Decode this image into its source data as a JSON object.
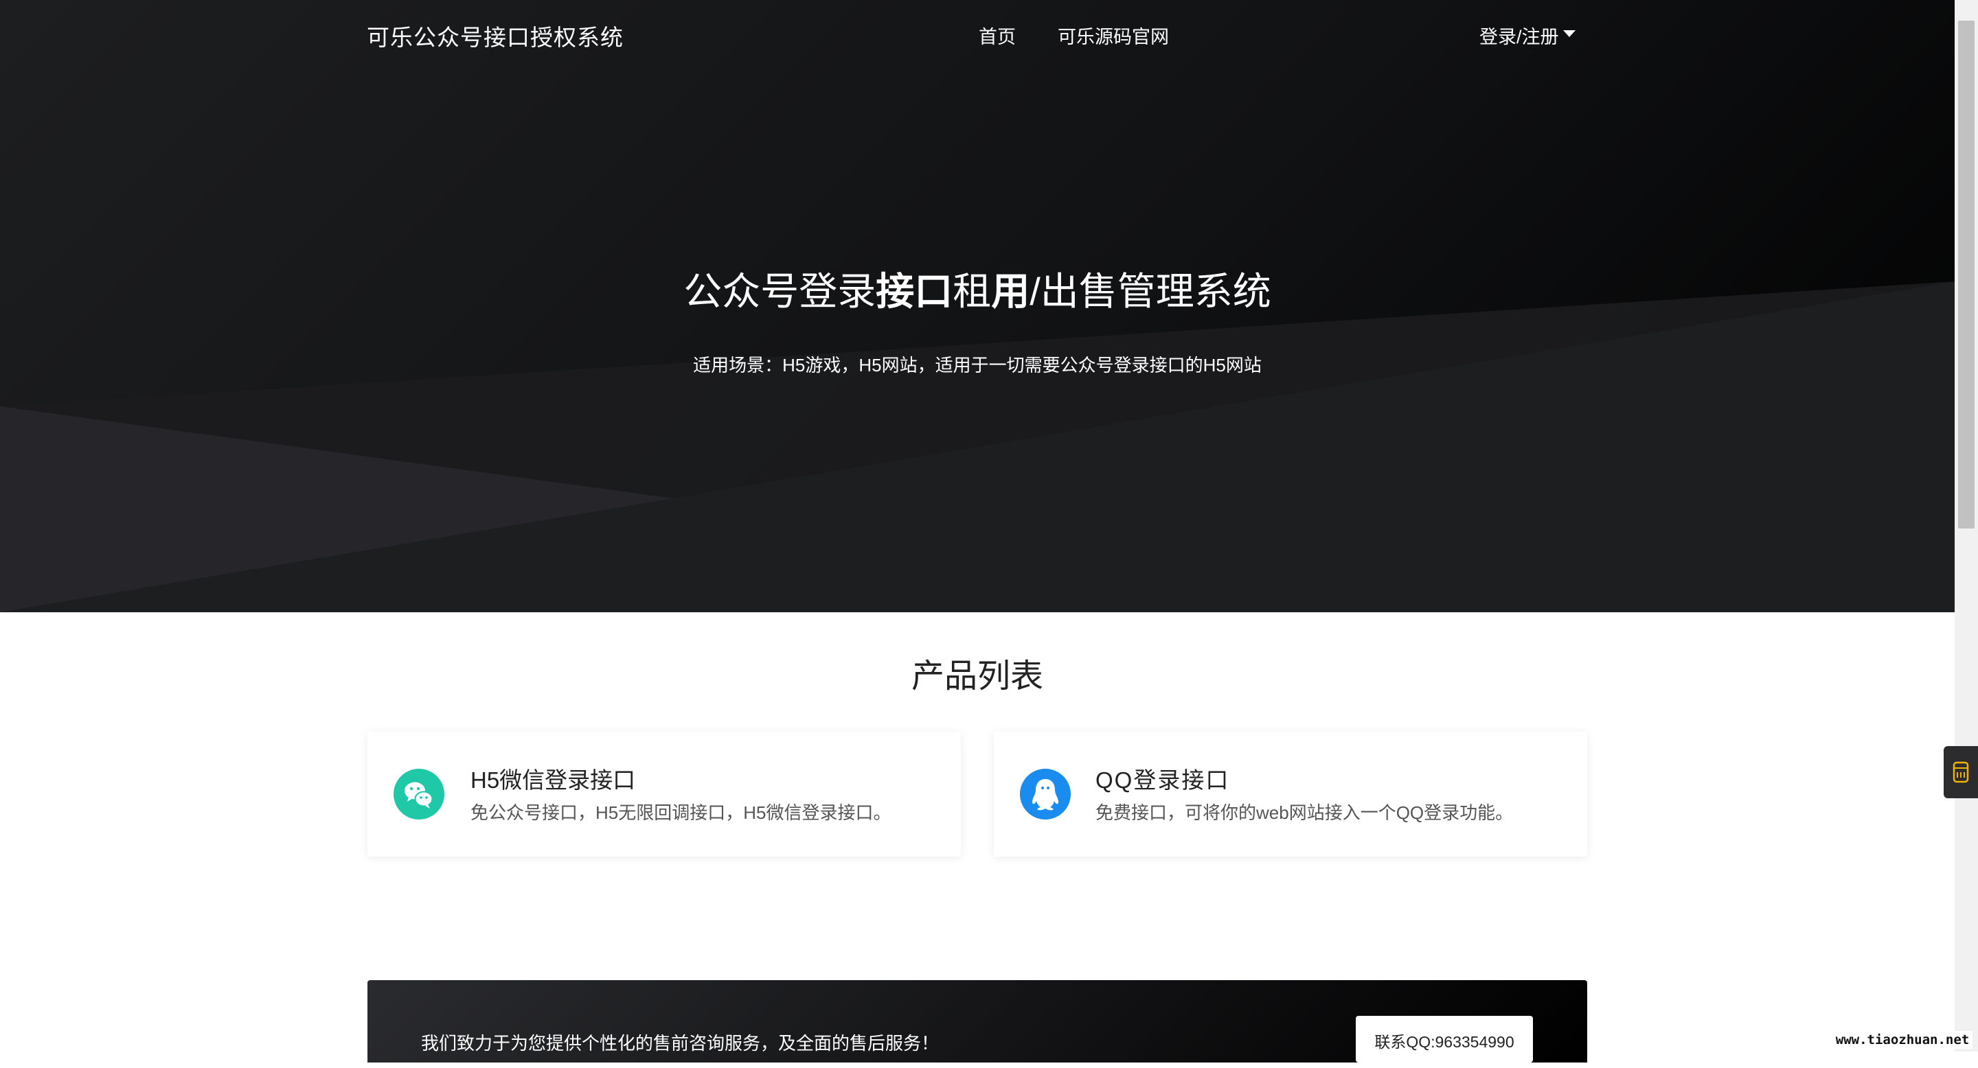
{
  "nav": {
    "brand": "可乐公众号接口授权系统",
    "links": [
      {
        "label": "首页"
      },
      {
        "label": "可乐源码官网"
      }
    ],
    "login_label": "登录/注册"
  },
  "hero": {
    "title_parts": [
      "公众号登录",
      "接口",
      "租",
      "用",
      "/出售管理系统"
    ],
    "subtitle": "适用场景：H5游戏，H5网站，适用于一切需要公众号登录接口的H5网站"
  },
  "products": {
    "section_title": "产品列表",
    "items": [
      {
        "title": "H5微信登录接口",
        "desc": "免公众号接口，H5无限回调接口，H5微信登录接口。",
        "icon": "wechat-icon",
        "color": "#1fc8a6"
      },
      {
        "title": "QQ登录接口",
        "desc": "免费接口，可将你的web网站接入一个QQ登录功能。",
        "icon": "qq-icon",
        "color": "#1a8cf0"
      }
    ]
  },
  "banner": {
    "text": "我们致力于为您提供个性化的售前咨询服务，及全面的售后服务！",
    "contact_button": "联系QQ:963354990"
  },
  "watermark": "www.tiaozhuan.net"
}
